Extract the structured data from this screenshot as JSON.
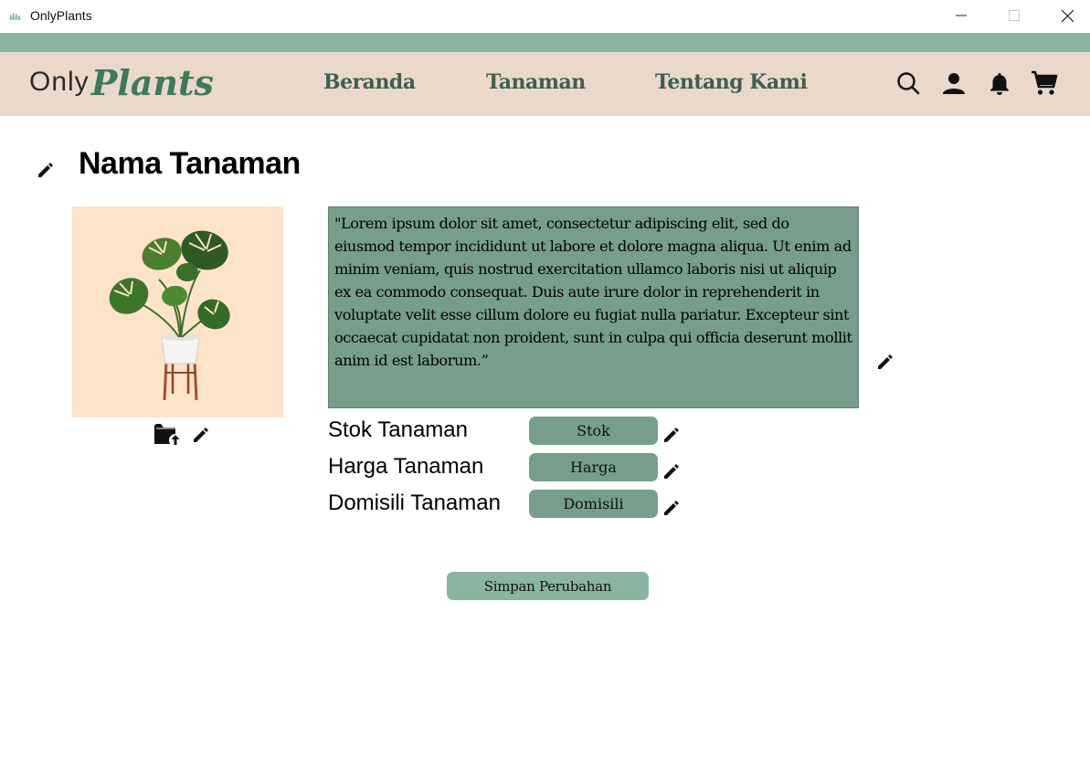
{
  "window": {
    "title": "OnlyPlants",
    "minimize_icon": "minimize-icon",
    "maximize_icon": "maximize-icon",
    "close_icon": "close-icon"
  },
  "navbar": {
    "logo_part1": "Only",
    "logo_part2": "Plants",
    "links": [
      "Beranda",
      "Tanaman",
      "Tentang Kami"
    ],
    "icons": [
      "search-icon",
      "user-icon",
      "bell-icon",
      "cart-icon"
    ],
    "background_color": "#ead8ca",
    "strip_color": "#89b5a0"
  },
  "page": {
    "title": "Nama Tanaman",
    "description": "\"Lorem ipsum dolor sit amet, consectetur adipiscing elit, sed do eiusmod tempor incididunt ut labore et dolore magna aliqua. Ut enim ad minim veniam, quis nostrud exercitation ullamco laboris nisi ut aliquip ex ea commodo consequat. Duis aute irure dolor in reprehenderit in voluptate velit esse cillum dolore eu fugiat nulla pariatur. Excepteur sint occaecat cupidatat non proident, sunt in culpa qui officia deserunt mollit anim id est laborum.”",
    "fields": [
      {
        "label": "Stok Tanaman",
        "value": "Stok"
      },
      {
        "label": "Harga Tanaman",
        "value": "Harga"
      },
      {
        "label": "Domisili Tanaman",
        "value": "Domisili"
      }
    ],
    "save_label": "Simpan Perubahan",
    "accent_color": "#779e8b",
    "image_background": "#fde3c8"
  }
}
